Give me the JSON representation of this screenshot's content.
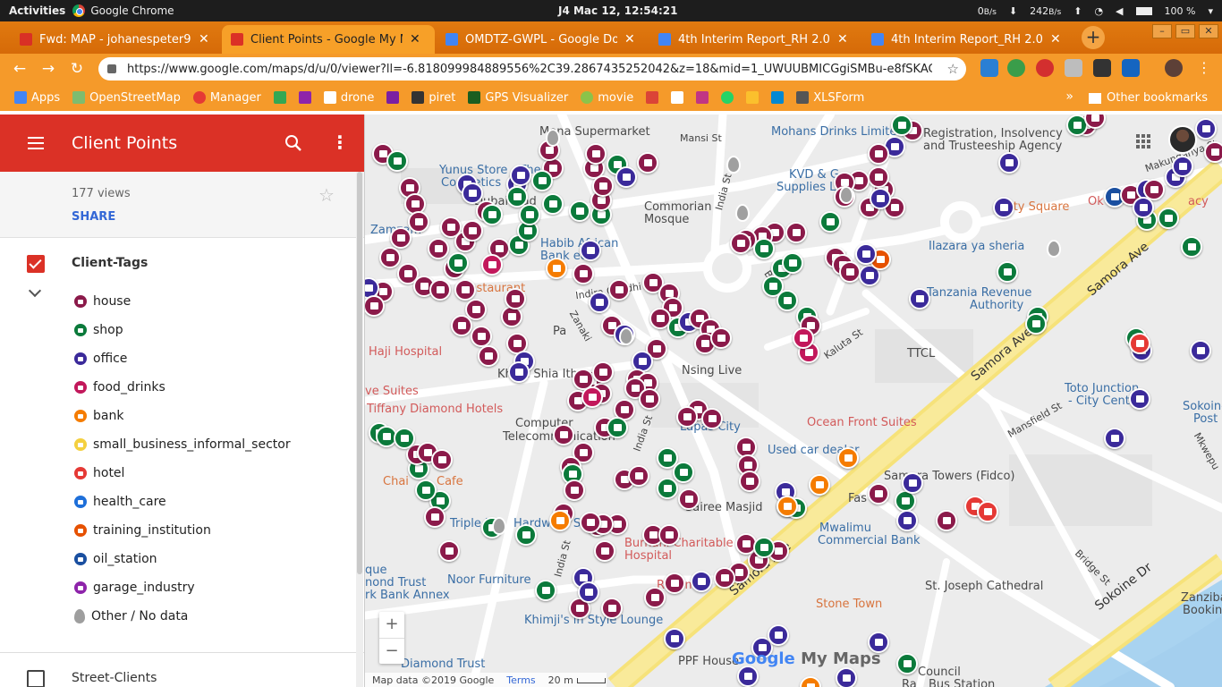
{
  "system_bar": {
    "activities": "Activities",
    "app_name": "Google Chrome",
    "clock": "J4 Mac 12, 12:54:21",
    "net_down": "0",
    "net_down_unit": "B/s",
    "net_up": "242",
    "net_up_unit": "B/s",
    "battery": "100 %"
  },
  "tabs": [
    {
      "title": "Fwd: MAP - johanespeter9",
      "color": "#d93025",
      "active": false
    },
    {
      "title": "Client Points - Google My M",
      "color": "#db3126",
      "active": true
    },
    {
      "title": "OMDTZ-GWPL - Google Doc",
      "color": "#4285f4",
      "active": false
    },
    {
      "title": "4th Interim Report_RH 2.0",
      "color": "#4285f4",
      "active": false
    },
    {
      "title": "4th Interim Report_RH 2.0",
      "color": "#4285f4",
      "active": false
    }
  ],
  "new_tab": "+",
  "address": {
    "url": "https://www.google.com/maps/d/u/0/viewer?ll=-6.818099984889556%2C39.2867435252042&z=18&mid=1_UWUUBMICGgiSMBu-e8fSKAClxMFdslr",
    "star": "☆"
  },
  "bookmarks": [
    {
      "label": "Apps",
      "color": "#4285f4"
    },
    {
      "label": "OpenStreetMap",
      "color": "#7ebc6f"
    },
    {
      "label": "Manager",
      "color": "#e53935"
    },
    {
      "label": "",
      "color": "#34a853"
    },
    {
      "label": "",
      "color": "#8e24aa"
    },
    {
      "label": "drone",
      "color": "#fff"
    },
    {
      "label": "",
      "color": "#7b1fa2"
    },
    {
      "label": "piret",
      "color": "#333"
    },
    {
      "label": "GPS Visualizer",
      "color": "#1b5e20"
    },
    {
      "label": "movie",
      "color": "#8bc34a"
    },
    {
      "label": "",
      "color": "#db4437"
    },
    {
      "label": "",
      "color": "#fff"
    },
    {
      "label": "",
      "color": "#c13584"
    },
    {
      "label": "",
      "color": "#25d366"
    },
    {
      "label": "",
      "color": "#fbc02d"
    },
    {
      "label": "",
      "color": "#0288d1"
    },
    {
      "label": "XLSForm",
      "color": "#555"
    }
  ],
  "bookmarks_more": "»",
  "other_bookmarks": "Other bookmarks",
  "panel": {
    "title": "Client Points",
    "views": "177 views",
    "share": "SHARE",
    "layer1": "Client-Tags",
    "layer2": "Street-Clients",
    "tags": [
      {
        "name": "house",
        "color": "#8b1a4a"
      },
      {
        "name": "shop",
        "color": "#0b7a3b"
      },
      {
        "name": "office",
        "color": "#3b2a9a"
      },
      {
        "name": "food_drinks",
        "color": "#c2185b"
      },
      {
        "name": "bank",
        "color": "#f57c00"
      },
      {
        "name": "small_business_informal_sector",
        "color": "#f4d03f"
      },
      {
        "name": "hotel",
        "color": "#e53935"
      },
      {
        "name": "health_care",
        "color": "#1e6fd9"
      },
      {
        "name": "training_institution",
        "color": "#e65100"
      },
      {
        "name": "oil_station",
        "color": "#1a4fa0"
      },
      {
        "name": "garage_industry",
        "color": "#8e24aa"
      },
      {
        "name": "Other / No data",
        "color": "#9e9e9e"
      }
    ]
  },
  "map": {
    "labels": {
      "mohans": "Mohans Drinks Limited",
      "registration": "Registration, Insolvency",
      "registration2": "and Trusteeship Agency",
      "kvd": "KVD & G",
      "supplies": "Supplies L",
      "city_square": "City Square",
      "yunus": "Yunus Store - The",
      "cosmetics": "Cosmetics",
      "dubai": "Dubai Trad",
      "commorian": "Commorian",
      "mosque": "Mosque",
      "habib": "Habib African",
      "bank_ed": "Bank    ed",
      "zamzam": "Zamzam",
      "restaurant": "Restaurant",
      "ilaza": "Ilazara ya sheria",
      "tanzania_rev": "Tanzania Revenue",
      "authority": "Authority",
      "ttcl": "TTCL",
      "toto": "Toto Junction",
      "city_centre": "- City Centre",
      "sokoine_post": "Sokoine",
      "post": "Post",
      "haji": "Haji Hospital",
      "suites": "ve Suites",
      "tiffany": "Tiffany Diamond Hotels",
      "khoja": "Khoja Shia Ith",
      "ocean_front": "Ocean Front Suites",
      "computer": "Computer",
      "telecom": "Telecommunication",
      "lapas": "Lapas City",
      "used_car": "Used car dealer",
      "samora_towers": "Samora Towers (Fidco)",
      "chai": "Chai",
      "cafe": "Cafe",
      "triple": "Triple H",
      "hardware": "Hardware Store",
      "sairee": "Sairee Masjid",
      "mwalimu": "Mwalimu",
      "commercial": "Commercial Bank",
      "burhani": "Burhani Charitable",
      "hospital": "Hospital",
      "noor": "Noor Furniture",
      "st_joseph": "St. Joseph Cathedral",
      "stone_town": "Stone Town",
      "khimji": "Khimji's in Style Lounge",
      "zanzibar": "Zanzibar Fa",
      "booking": "Booking Off",
      "diamond_trust": "Diamond Trust",
      "bank_annex": "Bank Annex",
      "ppf": "PPF House",
      "council": "Council",
      "bus_station": "Bus Station",
      "bus_sta_prefix": "Ra",
      "mansi": "Mansi St",
      "india_st": "India St",
      "india_st2": "India St",
      "indira": "Indira Gandhi St",
      "kaluta": "Kaluta St",
      "mansfield": "Mansfield St",
      "bridge": "Bridge St",
      "bridge2": "Bridge St",
      "samora_ave": "Samora Ave",
      "samora_ave2": "Samora Ave",
      "samora_ave3": "Samora Ave",
      "sokoine_dr": "Sokoine Dr",
      "makunganya": "Makunganya St",
      "mkwepu": "Mkwepu",
      "zanaki": "Zanaki",
      "okay": "Ok",
      "acy": "acy",
      "que": "que",
      "nond_trust": "nond Trust",
      "rk": "rk Bank Annex",
      "fas": "Fas",
      "ma": "Ma",
      "supermarket": "Mena Supermarket",
      "recoms": "Recoms",
      "nsing": "Nsing Live",
      "pa": "Pa"
    },
    "zoom_in": "+",
    "zoom_out": "−",
    "footer_data": "Map data ©2019 Google",
    "footer_terms": "Terms",
    "footer_scale": "20 m",
    "logo_google": "Google",
    "logo_mymaps": "My Maps"
  }
}
